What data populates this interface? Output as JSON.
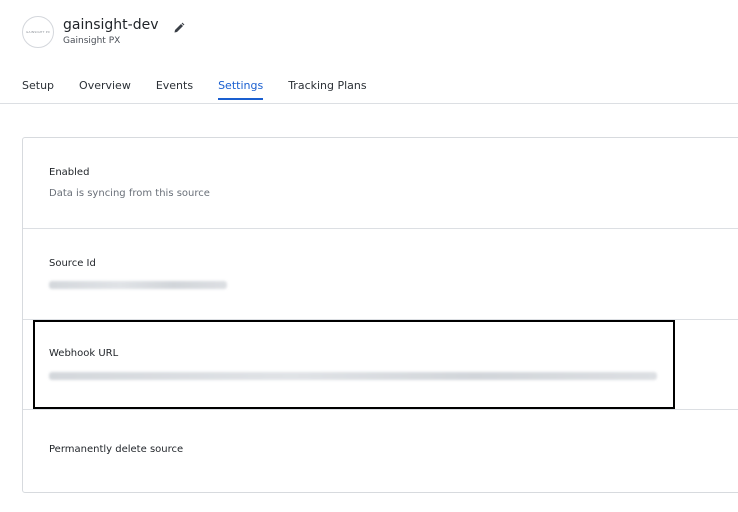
{
  "source": {
    "logo_text": "GAINSIGHT PX",
    "name": "gainsight-dev",
    "type": "Gainsight PX"
  },
  "tabs": [
    {
      "label": "Setup",
      "active": false
    },
    {
      "label": "Overview",
      "active": false
    },
    {
      "label": "Events",
      "active": false
    },
    {
      "label": "Settings",
      "active": true
    },
    {
      "label": "Tracking Plans",
      "active": false
    }
  ],
  "settings": {
    "enabled": {
      "label": "Enabled",
      "description": "Data is syncing from this source"
    },
    "source_id": {
      "label": "Source Id"
    },
    "webhook_url": {
      "label": "Webhook URL"
    },
    "delete": {
      "label": "Permanently delete source"
    }
  },
  "colors": {
    "accent": "#1a5fd0",
    "border": "#d7dade",
    "highlight": "#000000"
  }
}
